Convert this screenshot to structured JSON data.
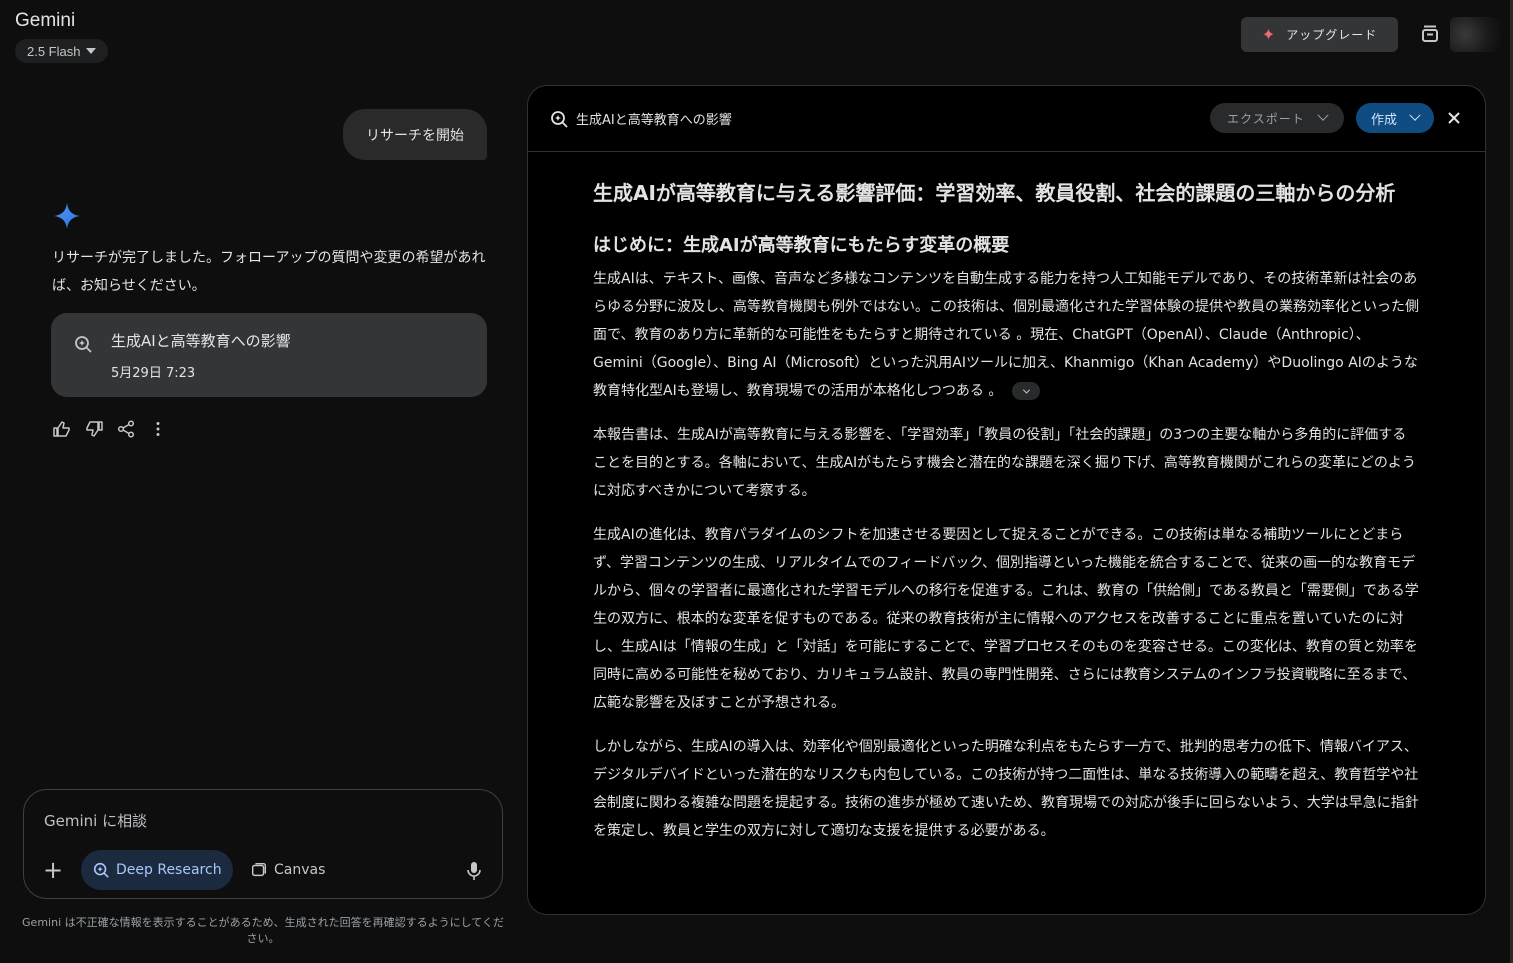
{
  "header": {
    "brand": "Gemini",
    "model": "2.5 Flash",
    "upgrade_label": "アップグレード"
  },
  "chat": {
    "user_message": "リサーチを開始",
    "reply": "リサーチが完了しました。フォローアップの質問や変更の希望があれば、お知らせください。",
    "doc_card": {
      "title": "生成AIと高等教育への影響",
      "date": "5月29日 7:23"
    }
  },
  "composer": {
    "placeholder": "Gemini に相談",
    "deep_research_label": "Deep Research",
    "canvas_label": "Canvas"
  },
  "disclaimer": "Gemini は不正確な情報を表示することがあるため、生成された回答を再確認するようにしてください。",
  "panel": {
    "title": "生成AIと高等教育への影響",
    "export_label": "エクスポート",
    "create_label": "作成"
  },
  "document": {
    "title": "生成AIが高等教育に与える影響評価：学習効率、教員役割、社会的課題の三軸からの分析",
    "section_heading": "はじめに：生成AIが高等教育にもたらす変革の概要",
    "paragraphs": [
      "生成AIは、テキスト、画像、音声など多様なコンテンツを自動生成する能力を持つ人工知能モデルであり、その技術革新は社会のあらゆる分野に波及し、高等教育機関も例外ではない。この技術は、個別最適化された学習体験の提供や教員の業務効率化といった側面で、教育のあり方に革新的な可能性をもたらすと期待されている 。現在、ChatGPT（OpenAI）、Claude（Anthropic）、Gemini（Google）、Bing AI（Microsoft）といった汎用AIツールに加え、Khanmigo（Khan Academy）やDuolingo AIのような教育特化型AIも登場し、教育現場での活用が本格化しつつある 。",
      "本報告書は、生成AIが高等教育に与える影響を、「学習効率」「教員の役割」「社会的課題」の3つの主要な軸から多角的に評価することを目的とする。各軸において、生成AIがもたらす機会と潜在的な課題を深く掘り下げ、高等教育機関がこれらの変革にどのように対応すべきかについて考察する。",
      "生成AIの進化は、教育パラダイムのシフトを加速させる要因として捉えることができる。この技術は単なる補助ツールにとどまらず、学習コンテンツの生成、リアルタイムでのフィードバック、個別指導といった機能を統合することで、従来の画一的な教育モデルから、個々の学習者に最適化された学習モデルへの移行を促進する。これは、教育の「供給側」である教員と「需要側」である学生の双方に、根本的な変革を促すものである。従来の教育技術が主に情報へのアクセスを改善することに重点を置いていたのに対し、生成AIは「情報の生成」と「対話」を可能にすることで、学習プロセスそのものを変容させる。この変化は、教育の質と効率を同時に高める可能性を秘めており、カリキュラム設計、教員の専門性開発、さらには教育システムのインフラ投資戦略に至るまで、広範な影響を及ぼすことが予想される。",
      "しかしながら、生成AIの導入は、効率化や個別最適化といった明確な利点をもたらす一方で、批判的思考力の低下、情報バイアス、デジタルデバイドといった潜在的なリスクも内包している。この技術が持つ二面性は、単なる技術導入の範疇を超え、教育哲学や社会制度に関わる複雑な問題を提起する。技術の進歩が極めて速いため、教育現場での対応が後手に回らないよう、大学は早急に指針を策定し、教員と学生の双方に対して適切な支援を提供する必要がある。"
    ]
  }
}
